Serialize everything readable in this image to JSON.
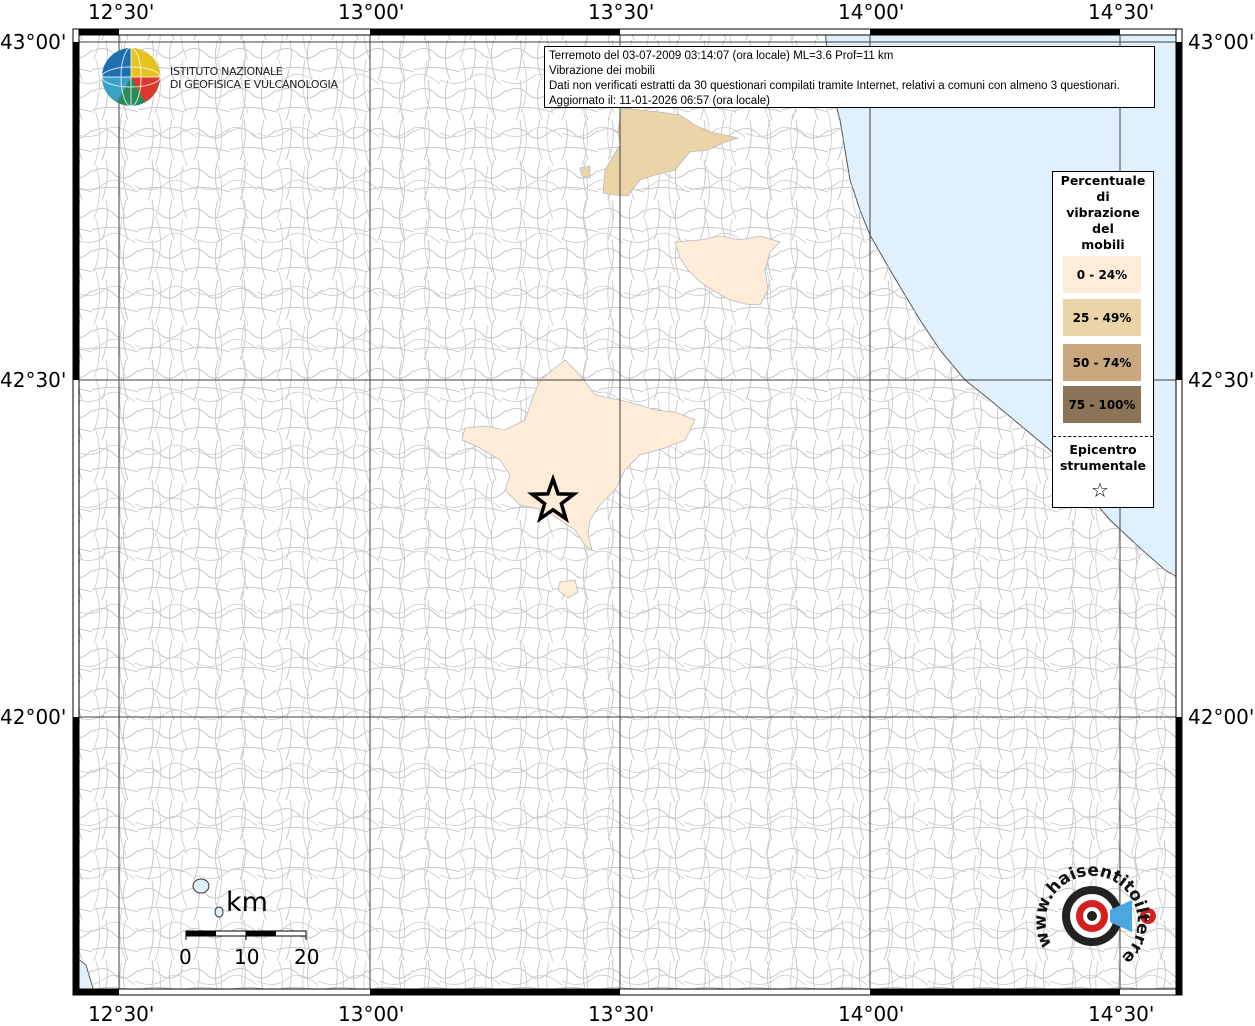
{
  "info_box": {
    "line1": "Terremoto del 03-07-2009 03:14:07 (ora locale) ML=3.6 Prof=11 km",
    "line2": "Vibrazione dei mobili",
    "line3": "Dati non verificati estratti da 30 questionari compilati tramite Internet, relativi a comuni con almeno 3 questionari.",
    "line4": "Aggiornato il: 11-01-2026 06:57 (ora locale)"
  },
  "ingv": {
    "line1": "ISTITUTO NAZIONALE",
    "line2": "DI GEOFISICA E VULCANOLOGIA"
  },
  "axes": {
    "longitudes": [
      "12°30'",
      "13°00'",
      "13°30'",
      "14°00'",
      "14°30'"
    ],
    "latitudes": [
      "43°00'",
      "42°30'",
      "42°00'"
    ]
  },
  "legend": {
    "title_lines": [
      "Percentuale",
      "di",
      "vibrazione",
      "del",
      "mobili"
    ],
    "classes": [
      {
        "label": "0 - 24%",
        "color": "#fcecd8"
      },
      {
        "label": "25 - 49%",
        "color": "#ead4a8"
      },
      {
        "label": "50 - 74%",
        "color": "#c8a87c"
      },
      {
        "label": "75 - 100%",
        "color": "#8a7356"
      }
    ],
    "epicenter_lines": [
      "Epicentro",
      "strumentale"
    ],
    "epicenter_symbol": "☆"
  },
  "scale_bar": {
    "unit": "km",
    "ticks": [
      "0",
      "10",
      "20"
    ]
  },
  "watermark": {
    "text": "haisentitoilterremoto.it",
    "prefix": "www."
  },
  "colors": {
    "sea": "#e0f0fc",
    "boundary": "#bdbdbd",
    "grid": "#404040"
  }
}
